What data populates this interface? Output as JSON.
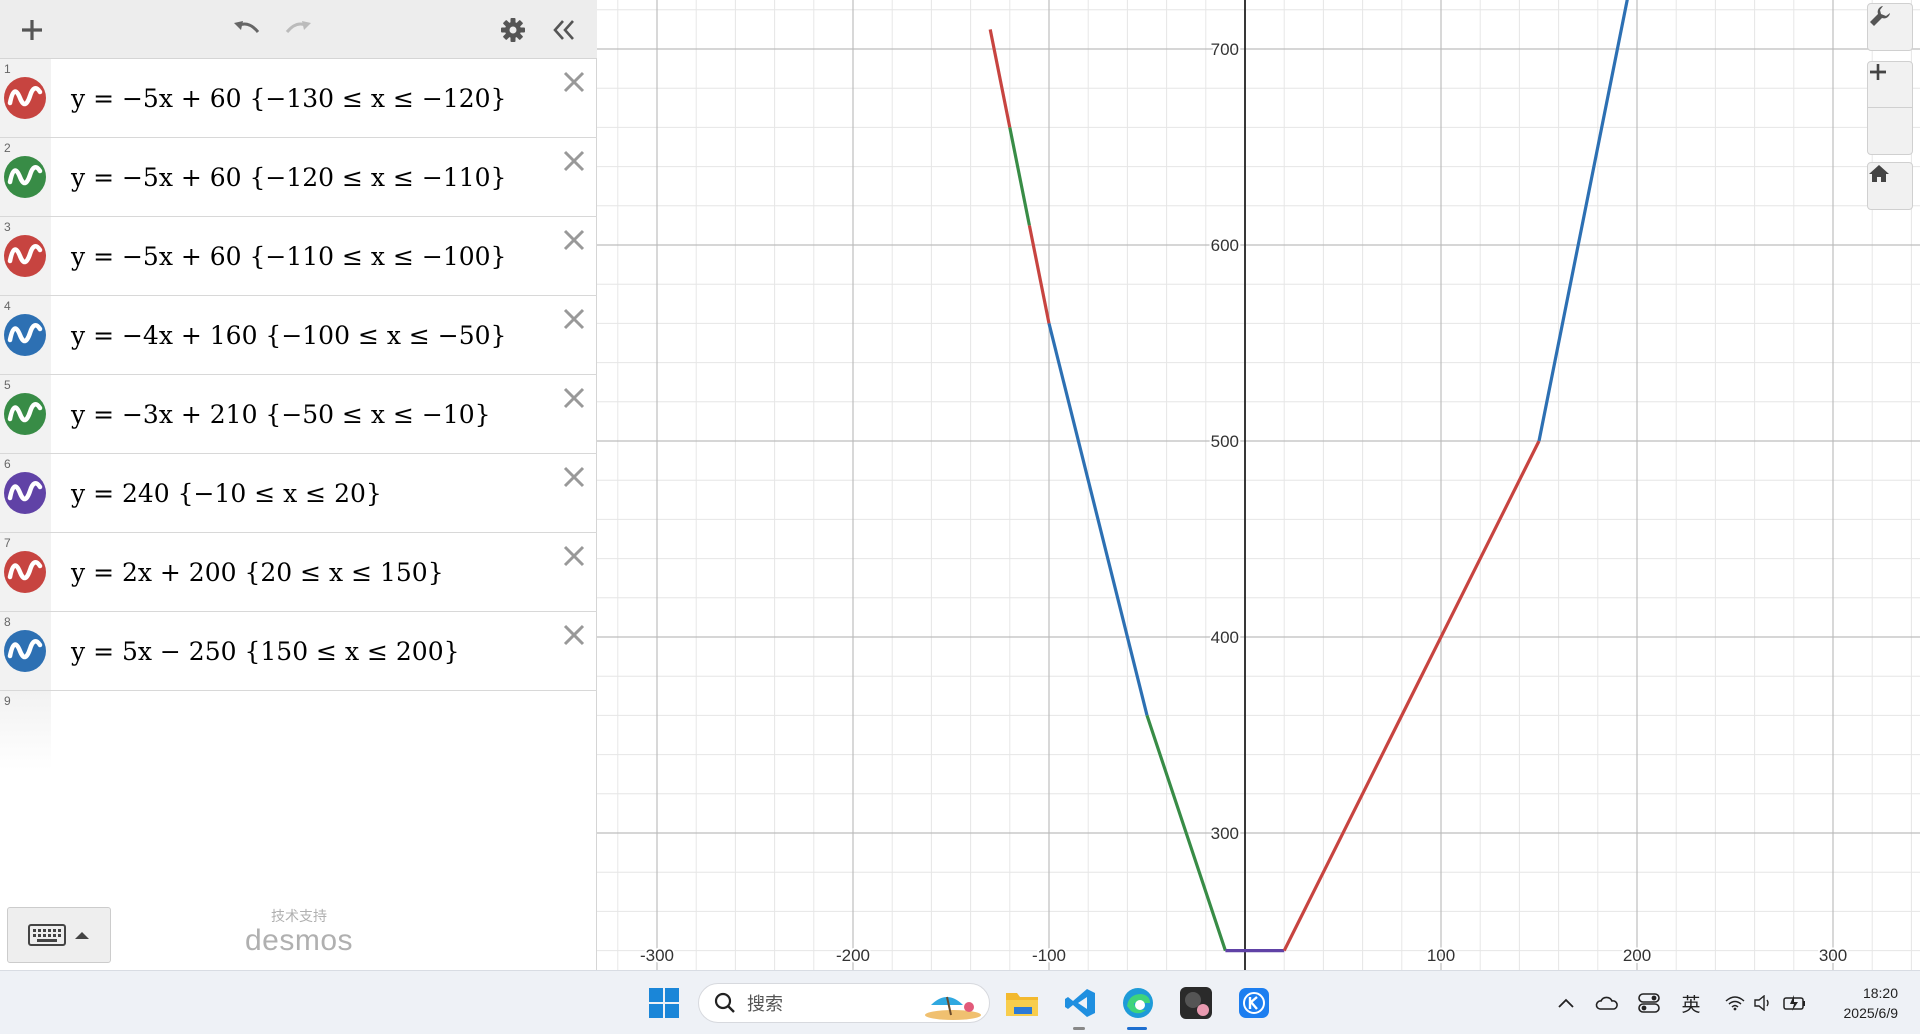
{
  "sidebar": {
    "expressions": [
      {
        "index": "1",
        "text": "y = −5x + 60 {−130 ≤ x ≤ −120}",
        "color": "#c74440"
      },
      {
        "index": "2",
        "text": "y = −5x + 60 {−120 ≤ x ≤ −110}",
        "color": "#388c46"
      },
      {
        "index": "3",
        "text": "y = −5x + 60 {−110 ≤ x ≤ −100}",
        "color": "#c74440"
      },
      {
        "index": "4",
        "text": "y = −4x + 160 {−100 ≤ x ≤ −50}",
        "color": "#2d70b3"
      },
      {
        "index": "5",
        "text": "y = −3x + 210 {−50 ≤ x ≤ −10}",
        "color": "#388c46"
      },
      {
        "index": "6",
        "text": "y = 240 {−10 ≤ x ≤ 20}",
        "color": "#6042a6"
      },
      {
        "index": "7",
        "text": "y = 2x + 200 {20 ≤ x ≤ 150}",
        "color": "#c74440"
      },
      {
        "index": "8",
        "text": "y = 5x − 250 {150 ≤ x ≤ 200}",
        "color": "#2d70b3"
      }
    ],
    "empty_index": "9",
    "powered_label": "技术支持",
    "powered_brand": "desmos"
  },
  "taskbar": {
    "search_placeholder": "搜索",
    "ime": "英",
    "time": "18:20",
    "date": "2025/6/9"
  },
  "chart_data": {
    "type": "line",
    "xlim": [
      -330,
      340
    ],
    "ylim": [
      236,
      725
    ],
    "x_ticks": [
      -300,
      -200,
      -100,
      100,
      200,
      300
    ],
    "x_tick_labels": [
      "-300",
      "-200",
      "-100",
      "100",
      "200",
      "300"
    ],
    "y_ticks": [
      300,
      400,
      500,
      600,
      700
    ],
    "y_tick_labels": [
      "300",
      "400",
      "500",
      "600",
      "700"
    ],
    "grid": true,
    "series": [
      {
        "color": "#c74440",
        "x": [
          -130,
          -120
        ],
        "y": [
          710,
          660
        ]
      },
      {
        "color": "#388c46",
        "x": [
          -120,
          -110
        ],
        "y": [
          660,
          610
        ]
      },
      {
        "color": "#c74440",
        "x": [
          -110,
          -100
        ],
        "y": [
          610,
          560
        ]
      },
      {
        "color": "#2d70b3",
        "x": [
          -100,
          -50
        ],
        "y": [
          560,
          360
        ]
      },
      {
        "color": "#388c46",
        "x": [
          -50,
          -10
        ],
        "y": [
          360,
          240
        ]
      },
      {
        "color": "#6042a6",
        "x": [
          -10,
          20
        ],
        "y": [
          240,
          240
        ]
      },
      {
        "color": "#c74440",
        "x": [
          20,
          150
        ],
        "y": [
          240,
          500
        ]
      },
      {
        "color": "#2d70b3",
        "x": [
          150,
          200
        ],
        "y": [
          500,
          750
        ]
      }
    ]
  }
}
